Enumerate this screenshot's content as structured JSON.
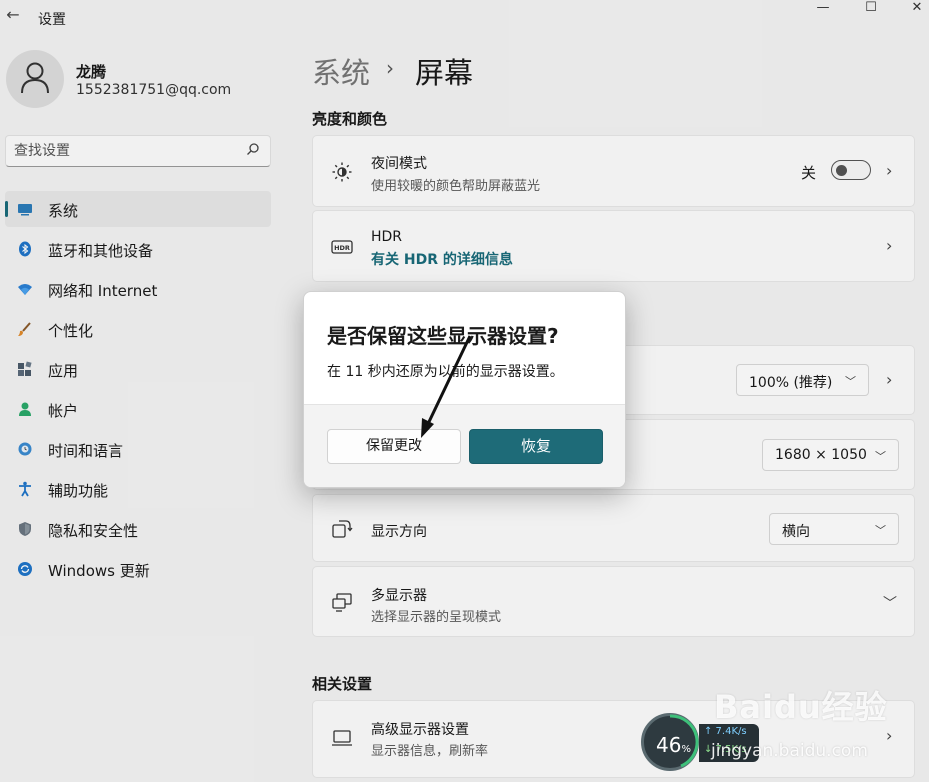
{
  "window": {
    "title": "设置",
    "back_icon": "back-arrow-icon",
    "minimize": "—",
    "maximize": "☐",
    "close": "✕"
  },
  "profile": {
    "name": "龙腾",
    "email": "1552381751@qq.com"
  },
  "search": {
    "placeholder": "查找设置"
  },
  "sidebar": {
    "items": [
      {
        "label": "系统",
        "icon": "display-icon",
        "selected": true
      },
      {
        "label": "蓝牙和其他设备",
        "icon": "bluetooth-icon"
      },
      {
        "label": "网络和 Internet",
        "icon": "wifi-icon"
      },
      {
        "label": "个性化",
        "icon": "brush-icon"
      },
      {
        "label": "应用",
        "icon": "apps-icon"
      },
      {
        "label": "帐户",
        "icon": "person-icon"
      },
      {
        "label": "时间和语言",
        "icon": "globe-clock-icon"
      },
      {
        "label": "辅助功能",
        "icon": "accessibility-icon"
      },
      {
        "label": "隐私和安全性",
        "icon": "shield-icon"
      },
      {
        "label": "Windows 更新",
        "icon": "update-icon"
      }
    ]
  },
  "breadcrumb": {
    "parent": "系统",
    "separator": "›",
    "current": "屏幕"
  },
  "sections": {
    "brightness_color": "亮度和颜色",
    "related": "相关设置"
  },
  "cards": {
    "night_light": {
      "title": "夜间模式",
      "subtitle": "使用较暖的颜色帮助屏蔽蓝光",
      "toggle_label": "关",
      "toggle_on": false
    },
    "hdr": {
      "title": "HDR",
      "link": "有关 HDR 的详细信息"
    },
    "scale": {
      "value": "100% (推荐)"
    },
    "resolution": {
      "value": "1680 × 1050"
    },
    "orientation": {
      "title": "显示方向",
      "value": "横向"
    },
    "multi_display": {
      "title": "多显示器",
      "subtitle": "选择显示器的呈现模式"
    },
    "advanced_display": {
      "title": "高级显示器设置",
      "subtitle": "显示器信息，刷新率"
    }
  },
  "dialog": {
    "title": "是否保留这些显示器设置?",
    "message": "在 11 秒内还原为以前的显示器设置。",
    "keep_label": "保留更改",
    "revert_label": "恢复"
  },
  "net_widget": {
    "percent": "46",
    "percent_unit": "%",
    "up": "↑ 7.4K/s",
    "down": "↓ 7.5K/s"
  },
  "watermark": {
    "logo": "Baidu经验",
    "url": "jingyan.baidu.com"
  },
  "colors": {
    "accent": "#1e6b78",
    "background": "#f2f2f2",
    "card": "#fbfbfb"
  }
}
